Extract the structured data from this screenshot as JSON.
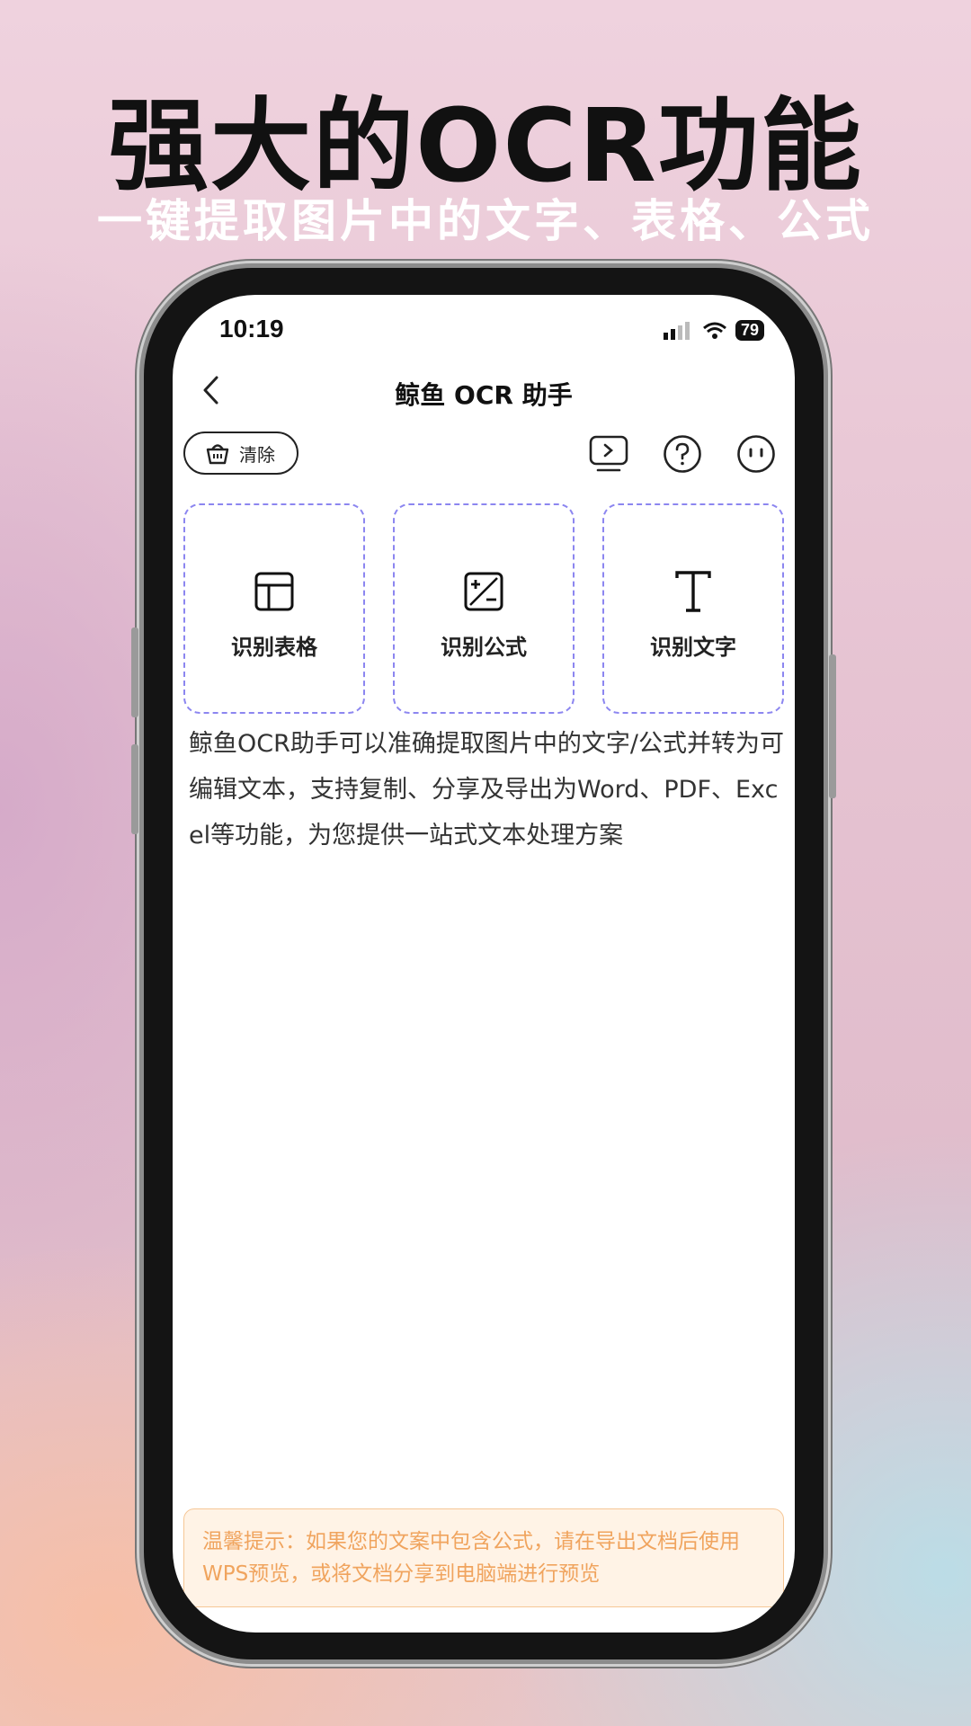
{
  "promo": {
    "headline": "强大的OCR功能",
    "subline": "一键提取图片中的文字、表格、公式"
  },
  "status_bar": {
    "time": "10:19",
    "battery": "79"
  },
  "nav": {
    "title": "鲸鱼 OCR 助手"
  },
  "toolbar": {
    "clear_label": "清除",
    "icons": [
      "video-guide-icon",
      "help-icon",
      "feedback-face-icon"
    ]
  },
  "cards": [
    {
      "label": "识别表格",
      "icon": "table-icon"
    },
    {
      "label": "识别公式",
      "icon": "formula-icon"
    },
    {
      "label": "识别文字",
      "icon": "text-icon"
    }
  ],
  "description": "鲸鱼OCR助手可以准确提取图片中的文字/公式并转为可编辑文本，支持复制、分享及导出为Word、PDF、Excel等功能，为您提供一站式文本处理方案",
  "tip": "温馨提示：如果您的文案中包含公式，请在导出文档后使用WPS预览，或将文档分享到电脑端进行预览",
  "colors": {
    "card_border": "#8c86f0",
    "tip_text": "#f0a45e",
    "tip_bg": "#fff3e6"
  }
}
